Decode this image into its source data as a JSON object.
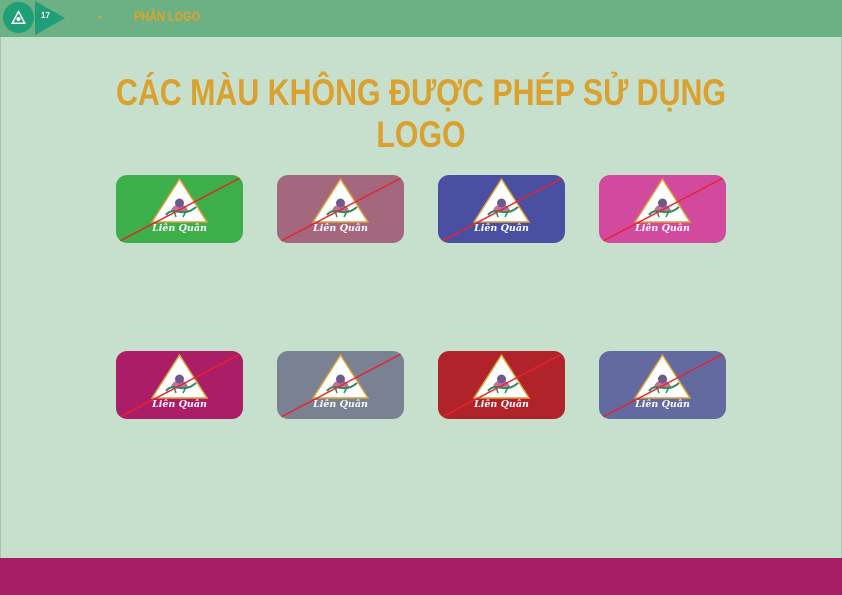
{
  "header": {
    "page_number": "17",
    "dot": "•",
    "section": "PHẦN LOGO"
  },
  "title": "CÁC MÀU KHÔNG ĐƯỢC PHÉP SỬ DỤNG LOGO",
  "logo_text": "Liên Quân",
  "colors": {
    "top_bar": "#6bb183",
    "badge": "#1f9e78",
    "background": "#c6e0cd",
    "title": "#dba12e",
    "bottom_bar": "#a81d66",
    "strike": "#e8212e"
  },
  "tiles": [
    {
      "color": "#3caf4a",
      "label": "Liên Quân"
    },
    {
      "color": "#a4687e",
      "label": "Liên Quân"
    },
    {
      "color": "#4a4fa1",
      "label": "Liên Quân"
    },
    {
      "color": "#d24a9d",
      "label": "Liên Quân"
    },
    {
      "color": "#ab1e67",
      "label": "Liên Quân"
    },
    {
      "color": "#7a8193",
      "label": "Liên Quân"
    },
    {
      "color": "#b0232a",
      "label": "Liên Quân"
    },
    {
      "color": "#636a9f",
      "label": "Liên Quân"
    }
  ]
}
